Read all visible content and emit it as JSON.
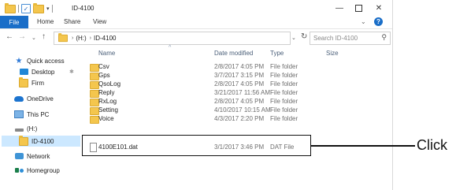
{
  "window": {
    "title": "ID-4100",
    "controls": {
      "minimize": "—",
      "close": "✕"
    }
  },
  "ribbon": {
    "file": "File",
    "tabs": [
      "Home",
      "Share",
      "View"
    ],
    "expand": "⌄",
    "help": "?"
  },
  "address": {
    "back": "←",
    "forward": "→",
    "recent": "⌄",
    "up": "↑",
    "path": [
      "(H:)",
      "ID-4100"
    ],
    "separator": "›",
    "dropdown": "⌄",
    "refresh": "↻",
    "search_placeholder": "Search ID-4100",
    "search_icon": "⚲"
  },
  "nav": {
    "items": [
      {
        "label": "Quick access",
        "icon": "star-icon"
      },
      {
        "label": "Desktop",
        "icon": "desktop-icon"
      },
      {
        "label": "Firm",
        "icon": "folder-icon"
      },
      {
        "label": "OneDrive",
        "icon": "cloud-icon"
      },
      {
        "label": "This PC",
        "icon": "computer-icon"
      },
      {
        "label": "(H:)",
        "icon": "drive-icon"
      },
      {
        "label": "ID-4100",
        "icon": "folder-icon"
      },
      {
        "label": "Network",
        "icon": "network-icon"
      },
      {
        "label": "Homegroup",
        "icon": "homegroup-icon"
      }
    ],
    "pin_symbol": "✱"
  },
  "columns": {
    "name": "Name",
    "date": "Date modified",
    "type": "Type",
    "size": "Size",
    "sort_caret": "^"
  },
  "files": [
    {
      "name": "Csv",
      "date": "2/8/2017 4:05 PM",
      "type": "File folder",
      "kind": "folder"
    },
    {
      "name": "Gps",
      "date": "3/7/2017 3:15 PM",
      "type": "File folder",
      "kind": "folder"
    },
    {
      "name": "QsoLog",
      "date": "2/8/2017 4:05 PM",
      "type": "File folder",
      "kind": "folder"
    },
    {
      "name": "Reply",
      "date": "3/21/2017 11:56 AM",
      "type": "File folder",
      "kind": "folder"
    },
    {
      "name": "RxLog",
      "date": "2/8/2017 4:05 PM",
      "type": "File folder",
      "kind": "folder"
    },
    {
      "name": "Setting",
      "date": "4/10/2017 10:15 AM",
      "type": "File folder",
      "kind": "folder"
    },
    {
      "name": "Voice",
      "date": "4/3/2017 2:20 PM",
      "type": "File folder",
      "kind": "folder"
    },
    {
      "name": "4100E101.dat",
      "date": "3/1/2017 3:46 PM",
      "type": "DAT File",
      "kind": "file"
    }
  ],
  "callout": {
    "label": "Click"
  }
}
